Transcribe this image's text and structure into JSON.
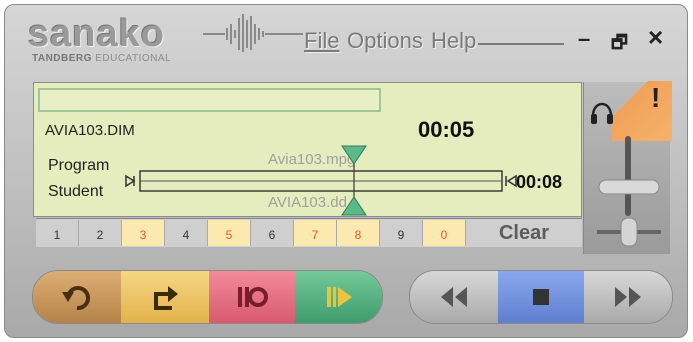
{
  "brand": {
    "name": "sanako",
    "sub_bold": "TANDBERG",
    "sub_rest": " EDUCATIONAL"
  },
  "menu": {
    "file": "File",
    "options": "Options",
    "help": "Help"
  },
  "window": {
    "minimize": "–",
    "restore": "🗗",
    "close": "×"
  },
  "display": {
    "filename": "AVIA103.DIM",
    "elapsed": "00:05",
    "remaining": "00:08",
    "program_label": "Program",
    "student_label": "Student",
    "program_track": "Avia103.mpg",
    "student_track": "AVIA103.dd"
  },
  "bookmarks": [
    {
      "label": "1",
      "active": false
    },
    {
      "label": "2",
      "active": false
    },
    {
      "label": "3",
      "active": true
    },
    {
      "label": "4",
      "active": false
    },
    {
      "label": "5",
      "active": true
    },
    {
      "label": "6",
      "active": false
    },
    {
      "label": "7",
      "active": true
    },
    {
      "label": "8",
      "active": true
    },
    {
      "label": "9",
      "active": false
    },
    {
      "label": "0",
      "active": true
    }
  ],
  "clear_label": "Clear",
  "alert_mark": "!",
  "colors": {
    "display": "#e5ecbd",
    "bookmark_on": "#fbe9b0",
    "marker": "#5bb98a",
    "undo": "#c9975a",
    "repeat": "#f2c969",
    "record": "#e86f82",
    "play": "#58b686",
    "stop": "#6f8ed8"
  },
  "icons": [
    "headphones-icon",
    "undo-icon",
    "repeat-icon",
    "record-icon",
    "play-from-icon",
    "rewind-icon",
    "stop-icon",
    "fast-forward-icon"
  ]
}
